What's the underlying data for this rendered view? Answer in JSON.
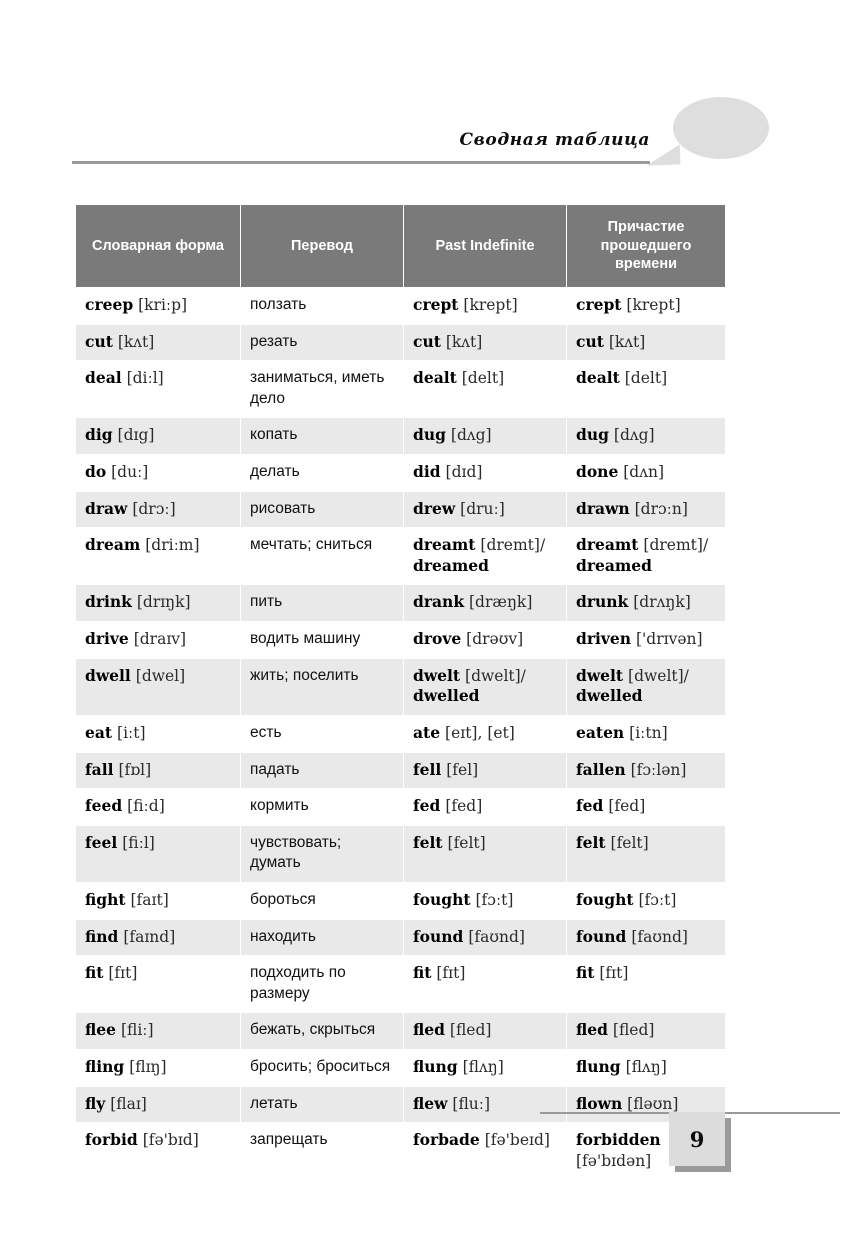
{
  "header": {
    "title": "Сводная таблица",
    "bubble_icon": "speech-bubble-icon"
  },
  "table": {
    "columns": [
      "Словарная форма",
      "Перевод",
      "Past Indefinite",
      "Причастие прошедшего времени"
    ],
    "rows": [
      {
        "infinitive_word": "creep",
        "infinitive_ipa": "[kriːp]",
        "translation": "ползать",
        "past_word": "crept",
        "past_ipa": "[krept]",
        "participle_word": "crept",
        "participle_ipa": "[krept]"
      },
      {
        "infinitive_word": "cut",
        "infinitive_ipa": "[kʌt]",
        "translation": "резать",
        "past_word": "cut",
        "past_ipa": "[kʌt]",
        "participle_word": "cut",
        "participle_ipa": "[kʌt]"
      },
      {
        "infinitive_word": "deal",
        "infinitive_ipa": "[diːl]",
        "translation": "заниматься, иметь дело",
        "past_word": "dealt",
        "past_ipa": "[delt]",
        "participle_word": "dealt",
        "participle_ipa": "[delt]"
      },
      {
        "infinitive_word": "dig",
        "infinitive_ipa": "[dɪg]",
        "translation": "копать",
        "past_word": "dug",
        "past_ipa": "[dʌg]",
        "participle_word": "dug",
        "participle_ipa": "[dʌg]"
      },
      {
        "infinitive_word": "do",
        "infinitive_ipa": "[duː]",
        "translation": "делать",
        "past_word": "did",
        "past_ipa": "[dɪd]",
        "participle_word": "done",
        "participle_ipa": "[dʌn]"
      },
      {
        "infinitive_word": "draw",
        "infinitive_ipa": "[drɔː]",
        "translation": "рисовать",
        "past_word": "drew",
        "past_ipa": "[druː]",
        "participle_word": "drawn",
        "participle_ipa": "[drɔːn]"
      },
      {
        "infinitive_word": "dream",
        "infinitive_ipa": "[driːm]",
        "translation": "мечтать; сниться",
        "past_word": "dreamt",
        "past_ipa": "[dremt]/",
        "past_alt": "dreamed",
        "participle_word": "dreamt",
        "participle_ipa": "[dremt]/",
        "participle_alt": "dreamed"
      },
      {
        "infinitive_word": "drink",
        "infinitive_ipa": "[drɪŋk]",
        "translation": "пить",
        "past_word": "drank",
        "past_ipa": "[dræŋk]",
        "participle_word": "drunk",
        "participle_ipa": "[drʌŋk]"
      },
      {
        "infinitive_word": "drive",
        "infinitive_ipa": "[draɪv]",
        "translation": "водить машину",
        "past_word": "drove",
        "past_ipa": "[drəʊv]",
        "participle_word": "driven",
        "participle_ipa": "['drɪvən]"
      },
      {
        "infinitive_word": "dwell",
        "infinitive_ipa": "[dwel]",
        "translation": "жить; поселить",
        "past_word": "dwelt",
        "past_ipa": "[dwelt]/",
        "past_alt": "dwelled",
        "participle_word": "dwelt",
        "participle_ipa": "[dwelt]/",
        "participle_alt": "dwelled"
      },
      {
        "infinitive_word": "eat",
        "infinitive_ipa": "[iːt]",
        "translation": "есть",
        "past_word": "ate",
        "past_ipa": "[eɪt], [et]",
        "participle_word": "eaten",
        "participle_ipa": "[iːtn]"
      },
      {
        "infinitive_word": "fall",
        "infinitive_ipa": "[fɒl]",
        "translation": "падать",
        "past_word": "fell",
        "past_ipa": "[fel]",
        "participle_word": "fallen",
        "participle_ipa": "[fɔːlən]"
      },
      {
        "infinitive_word": "feed",
        "infinitive_ipa": "[fiːd]",
        "translation": "кормить",
        "past_word": "fed",
        "past_ipa": "[fed]",
        "participle_word": "fed",
        "participle_ipa": "[fed]"
      },
      {
        "infinitive_word": "feel",
        "infinitive_ipa": "[fiːl]",
        "translation": "чувствовать; думать",
        "past_word": "felt",
        "past_ipa": "[felt]",
        "participle_word": "felt",
        "participle_ipa": "[felt]"
      },
      {
        "infinitive_word": "fight",
        "infinitive_ipa": "[faɪt]",
        "translation": "бороться",
        "past_word": "fought",
        "past_ipa": "[fɔːt]",
        "participle_word": "fought",
        "participle_ipa": "[fɔːt]"
      },
      {
        "infinitive_word": "find",
        "infinitive_ipa": "[faɪnd]",
        "translation": "находить",
        "past_word": "found",
        "past_ipa": "[faʊnd]",
        "participle_word": "found",
        "participle_ipa": "[faʊnd]"
      },
      {
        "infinitive_word": "fit",
        "infinitive_ipa": "[fɪt]",
        "translation": "подходить по размеру",
        "past_word": "fit",
        "past_ipa": "[fɪt]",
        "participle_word": "fit",
        "participle_ipa": "[fɪt]"
      },
      {
        "infinitive_word": "flee",
        "infinitive_ipa": "[fliː]",
        "translation": "бежать, скрыться",
        "past_word": "fled",
        "past_ipa": "[fled]",
        "participle_word": "fled",
        "participle_ipa": "[fled]"
      },
      {
        "infinitive_word": "fling",
        "infinitive_ipa": "[flɪŋ]",
        "translation": "бросить; броситься",
        "past_word": "flung",
        "past_ipa": "[flʌŋ]",
        "participle_word": "flung",
        "participle_ipa": "[flʌŋ]"
      },
      {
        "infinitive_word": "fly",
        "infinitive_ipa": "[flaɪ]",
        "translation": "летать",
        "past_word": "flew",
        "past_ipa": "[fluː]",
        "participle_word": "flown",
        "participle_ipa": "[fləʊn]"
      },
      {
        "infinitive_word": "forbid",
        "infinitive_ipa": "[fə'bɪd]",
        "translation": "запрещать",
        "past_word": "forbade",
        "past_ipa": "[fə'beɪd]",
        "participle_word": "forbidden",
        "participle_ipa": "[fə'bɪdən]"
      }
    ]
  },
  "footer": {
    "page_number": "9"
  },
  "colors": {
    "header_fill": "#7a7a7a",
    "row_shade": "#e9e9e9",
    "rule": "#9a9a9a",
    "bubble": "#dedede",
    "page_box": "#dcdcdc"
  }
}
